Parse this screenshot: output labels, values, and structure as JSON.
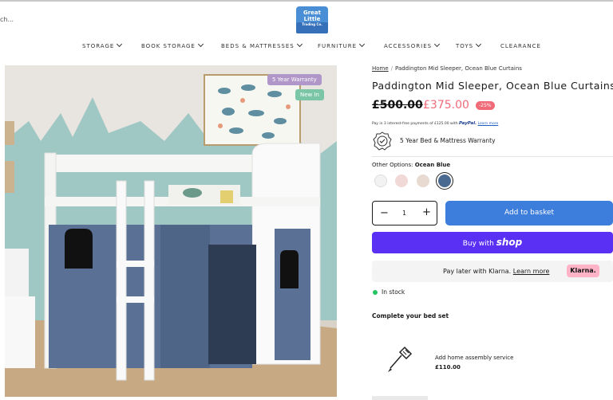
{
  "header": {
    "search_stub": "ch...",
    "logo_lines": [
      "Great",
      "Little",
      "Trading Co."
    ]
  },
  "nav": {
    "items": [
      {
        "label": "STORAGE",
        "chevron": true
      },
      {
        "label": "BOOK STORAGE",
        "chevron": true
      },
      {
        "label": "BEDS & MATTRESSES",
        "chevron": true
      },
      {
        "label": "FURNITURE",
        "chevron": true
      },
      {
        "label": "ACCESSORIES",
        "chevron": true
      },
      {
        "label": "TOYS",
        "chevron": true
      },
      {
        "label": "CLEARANCE",
        "chevron": false
      }
    ]
  },
  "badges": {
    "warranty": "5 Year Warranty",
    "new": "New In"
  },
  "breadcrumb": {
    "home": "Home",
    "separator": "/",
    "current": "Paddington Mid Sleeper, Ocean Blue Curtains"
  },
  "product": {
    "title": "Paddington Mid Sleeper, Ocean Blue Curtains",
    "price_old": "£500.00",
    "price_new": "£375.00",
    "discount": "-25%",
    "paypal_prefix": "Pay in 3 interest-free payments of £125.00 with",
    "paypal_brand": "PayPal.",
    "paypal_link": "Learn more",
    "warranty": "5 Year Bed & Mattress Warranty",
    "options_label": "Other Options:",
    "options_selected": "Ocean Blue",
    "swatches": [
      "#f2f2f2",
      "#f0d9d6",
      "#e8d9d1",
      "#4b6a90"
    ],
    "quantity": "1",
    "qty_minus": "−",
    "qty_plus": "+",
    "add_to_basket": "Add to basket",
    "buy_with": "Buy with",
    "shop_brand": "shop",
    "klarna_text": "Pay later with Klarna.",
    "klarna_link": "Learn more",
    "klarna_brand": "Klarna.",
    "stock": "In stock",
    "bed_set": "Complete your bed set",
    "assembly_label": "Add home assembly service",
    "assembly_price": "£110.00"
  },
  "colors": {
    "accent_blue": "#3d7edc",
    "shop_purple": "#5a31f4",
    "sale_pink": "#f06a78",
    "klarna_pink": "#ffb3c7",
    "stock_green": "#22c55e",
    "curtain_blue": "#5a7095"
  },
  "icons": {
    "warranty": "badge-check-icon",
    "assembly": "screwdriver-icon"
  }
}
